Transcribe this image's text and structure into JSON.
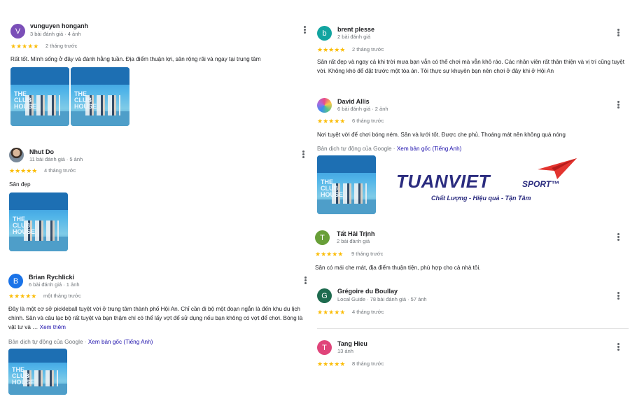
{
  "reviews": [
    {
      "id": "vunguyen",
      "name": "vunguyen honganh",
      "meta": "3 bài đánh giá · 4 ảnh",
      "initial": "V",
      "avatar_color": "#7b4fb8",
      "time": "2 tháng trước",
      "text": "Rất tốt. Mình sống ở đây và đánh hằng tuần. Địa điểm thuận lợi, sân rộng rãi và ngay tại trung tâm"
    },
    {
      "id": "nhutdo",
      "name": "Nhut Do",
      "meta": "11 bài đánh giá · 5 ảnh",
      "initial": "",
      "avatar_color": "#6d5a4a",
      "time": "4 tháng trước",
      "text": "Sân đẹp"
    },
    {
      "id": "brian",
      "name": "Brian Rychlicki",
      "meta": "6 bài đánh giá · 1 ảnh",
      "initial": "B",
      "avatar_color": "#1a73e8",
      "time": "một tháng trước",
      "text": "Đây là một cơ sở pickleball tuyệt vời ở trung tâm thành phố Hội An. Chỉ cần đi bộ một đoạn ngắn là đến khu du lịch chính. Sân và câu lạc bộ rất tuyệt và bạn thậm chí có thể lấy vợt để sử dụng nếu bạn không có vợt để chơi. Bóng là vật tư và …",
      "more": "Xem thêm",
      "translate_label": "Bản dịch tự động của Google ·",
      "translate_link": "Xem bản gốc (Tiếng Anh)"
    },
    {
      "id": "brent",
      "name": "brent plesse",
      "meta": "2 bài đánh giá",
      "initial": "b",
      "avatar_color": "#12a4a0",
      "time": "2 tháng trước",
      "text": "Sân rất đẹp và ngay cả khi trời mưa bạn vẫn có thể chơi mà vẫn khô ráo. Các nhân viên rất thân thiện và vị trí cũng tuyệt vời. Không khó để đặt trước một tòa án. Tôi thực sự khuyên bạn nên chơi ở đây khi ở Hội An"
    },
    {
      "id": "david",
      "name": "David Allis",
      "meta": "6 bài đánh giá · 2 ảnh",
      "initial": "",
      "avatar_color": "#c9c9ff",
      "time": "6 tháng trước",
      "text": "Nơi tuyệt vời để chơi bóng ném. Sân và lưới tốt. Được che phủ. Thoáng mát nên không quá nóng",
      "translate_label": "Bản dịch tự động của Google ·",
      "translate_link": "Xem bản gốc (Tiếng Anh)"
    },
    {
      "id": "tathai",
      "name": "Tất Hải Trịnh",
      "meta": "2 bài đánh giá",
      "initial": "T",
      "avatar_color": "#689f38",
      "time": "9 tháng trước",
      "text": "Sân có mái che mát, địa điểm thuận tiện, phù hợp cho cả nhà tôi."
    },
    {
      "id": "gregoire",
      "name": "Grégoire du Boullay",
      "meta": "Local Guide · 78 bài đánh giá · 57 ảnh",
      "initial": "G",
      "avatar_color": "#1e6b4f",
      "time": "4 tháng trước",
      "text": ""
    },
    {
      "id": "tanghieu",
      "name": "Tang Hieu",
      "meta": "13 ảnh",
      "initial": "T",
      "avatar_color": "#e0447a",
      "time": "8 tháng trước",
      "text": ""
    }
  ],
  "stars": "★★★★★",
  "photo_caption": {
    "line1": "THE",
    "line2": "CLUB",
    "line3": "HOUSE"
  },
  "logo": {
    "brand": "TUANVIET",
    "sport": "SPORT™",
    "tagline": "Chất Lượng - Hiệu quả - Tận Tâm",
    "accent": "#e3342f",
    "brand_color": "#2b2c7f"
  }
}
